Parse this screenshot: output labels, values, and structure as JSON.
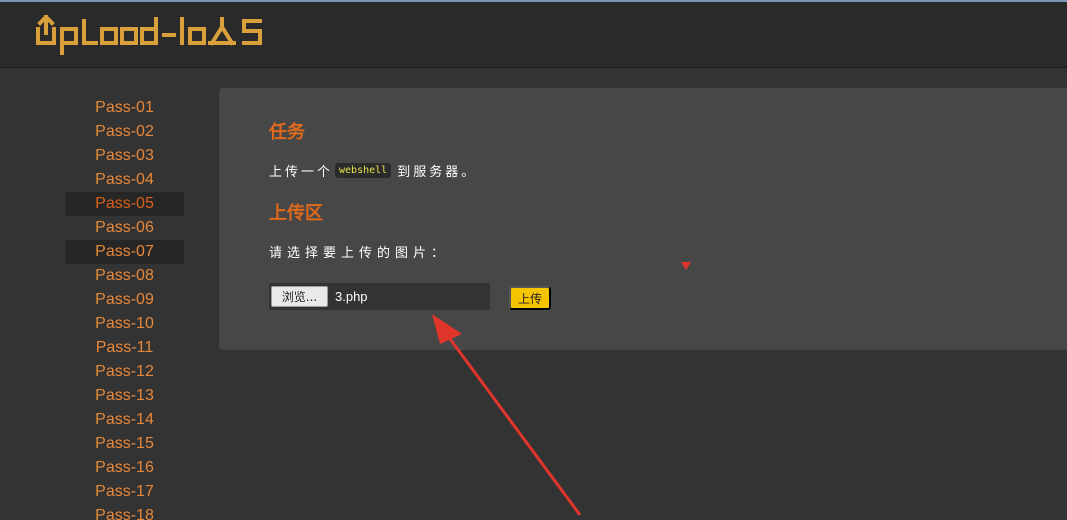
{
  "header": {
    "logo_text": "Upload-labs"
  },
  "sidebar": {
    "items": [
      {
        "label": "Pass-01"
      },
      {
        "label": "Pass-02"
      },
      {
        "label": "Pass-03"
      },
      {
        "label": "Pass-04"
      },
      {
        "label": "Pass-05"
      },
      {
        "label": "Pass-06"
      },
      {
        "label": "Pass-07"
      },
      {
        "label": "Pass-08"
      },
      {
        "label": "Pass-09"
      },
      {
        "label": "Pass-10"
      },
      {
        "label": "Pass-11"
      },
      {
        "label": "Pass-12"
      },
      {
        "label": "Pass-13"
      },
      {
        "label": "Pass-14"
      },
      {
        "label": "Pass-15"
      },
      {
        "label": "Pass-16"
      },
      {
        "label": "Pass-17"
      },
      {
        "label": "Pass-18"
      }
    ],
    "current": "Pass-05",
    "highlighted": [
      "Pass-05",
      "Pass-07"
    ]
  },
  "task": {
    "title": "任务",
    "text_before": "上传一个",
    "code": "webshell",
    "text_after": "到服务器。"
  },
  "upload": {
    "title": "上传区",
    "prompt": "请选择要上传的图片：",
    "browse_label": "浏览...",
    "file_name": "3.php",
    "submit_label": "上传"
  },
  "colors": {
    "background": "#333333",
    "panel": "#474747",
    "accent_orange": "#e1691c",
    "nav_text": "#e8883a",
    "upload_button": "#f5c400",
    "annotation_red": "#e0352b"
  }
}
